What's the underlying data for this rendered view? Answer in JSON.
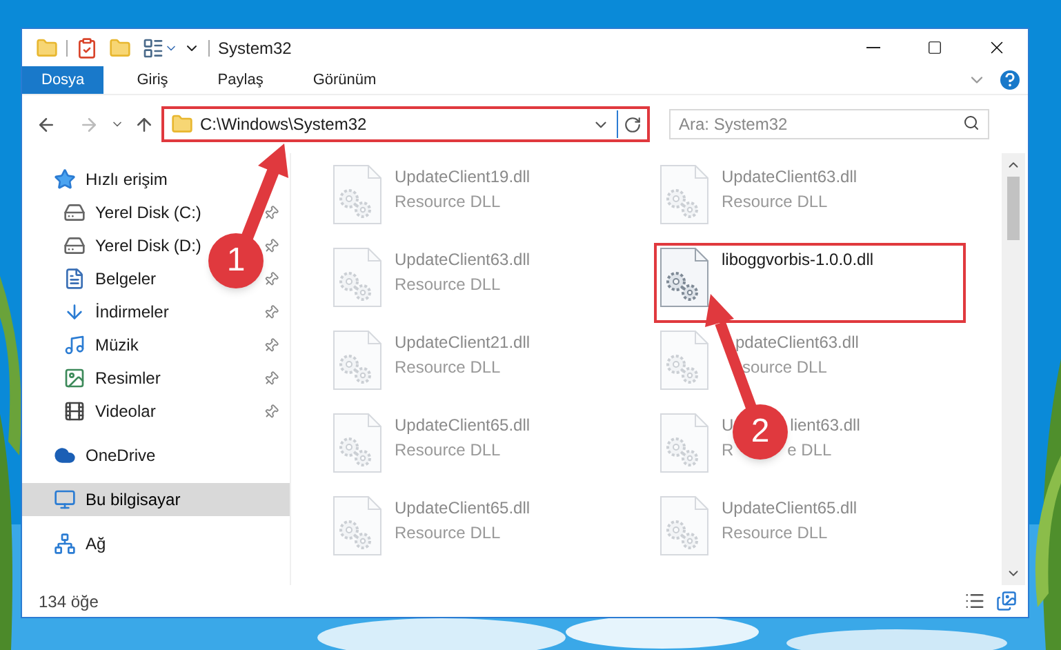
{
  "window": {
    "title": "System32"
  },
  "ribbon": {
    "tabs": [
      {
        "label": "Dosya",
        "kind": "file"
      },
      {
        "label": "Giriş",
        "kind": "tab"
      },
      {
        "label": "Paylaş",
        "kind": "tab"
      },
      {
        "label": "Görünüm",
        "kind": "tab"
      }
    ]
  },
  "address": {
    "path": "C:\\Windows\\System32",
    "highlighted": true
  },
  "search": {
    "placeholder": "Ara: System32"
  },
  "sidebar": {
    "items": [
      {
        "label": "Hızlı erişim",
        "kind": "star",
        "selected": false,
        "children": [
          {
            "label": "Yerel Disk (C:)",
            "kind": "drive",
            "selected": false,
            "pinned": true
          },
          {
            "label": "Yerel Disk (D:)",
            "kind": "drive",
            "selected": false,
            "pinned": true
          },
          {
            "label": "Belgeler",
            "kind": "document",
            "selected": false,
            "pinned": true
          },
          {
            "label": "İndirmeler",
            "kind": "download",
            "selected": false,
            "pinned": true
          },
          {
            "label": "Müzik",
            "kind": "music",
            "selected": false,
            "pinned": true
          },
          {
            "label": "Resimler",
            "kind": "pictures",
            "selected": false,
            "pinned": true
          },
          {
            "label": "Videolar",
            "kind": "videos",
            "selected": false,
            "pinned": true
          }
        ]
      },
      {
        "label": "OneDrive",
        "kind": "cloud",
        "selected": false
      },
      {
        "label": "Bu bilgisayar",
        "kind": "computer",
        "selected": true
      },
      {
        "label": "Ağ",
        "kind": "network",
        "selected": false
      }
    ]
  },
  "files": [
    {
      "name": "UpdateClient19.dll",
      "type": "Resource DLL",
      "dimmed": true,
      "highlighted": false
    },
    {
      "name": "UpdateClient63.dll",
      "type": "Resource DLL",
      "dimmed": true,
      "highlighted": false
    },
    {
      "name": "UpdateClient63.dll",
      "type": "Resource DLL",
      "dimmed": true,
      "highlighted": false
    },
    {
      "name": "liboggvorbis-1.0.0.dll",
      "dimmed": false,
      "highlighted": true
    },
    {
      "name": "UpdateClient21.dll",
      "type": "Resource DLL",
      "dimmed": true,
      "highlighted": false
    },
    {
      "kind": "hidden-start",
      "name": "pdateClient63.dll",
      "type": "source DLL",
      "dimmed": true,
      "highlighted": false
    },
    {
      "name": "UpdateClient65.dll",
      "type": "Resource DLL",
      "dimmed": true,
      "highlighted": false
    },
    {
      "kind": "hidden-middle",
      "name_parts": [
        "U",
        "lient63.dll"
      ],
      "type_parts": [
        "R",
        "e DLL"
      ],
      "dimmed": true,
      "highlighted": false
    },
    {
      "name": "UpdateClient65.dll",
      "type": "Resource DLL",
      "dimmed": true,
      "highlighted": false
    },
    {
      "name": "UpdateClient65.dll",
      "type": "Resource DLL",
      "dimmed": true,
      "highlighted": false
    }
  ],
  "status_bar": {
    "count": "134 öğe"
  },
  "callouts": [
    {
      "label": "1"
    },
    {
      "label": "2"
    }
  ]
}
